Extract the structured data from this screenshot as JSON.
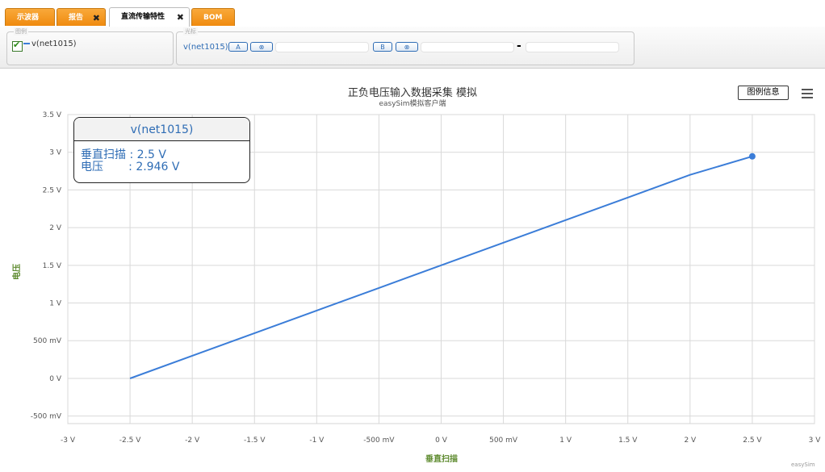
{
  "tabs": [
    {
      "label": "示波器",
      "closable": false,
      "active": false
    },
    {
      "label": "报告",
      "closable": true,
      "active": false
    },
    {
      "label": "直流传输特性",
      "closable": true,
      "active": true
    },
    {
      "label": "BOM",
      "closable": false,
      "active": false
    }
  ],
  "legend_panel": {
    "label": "图例",
    "items": [
      {
        "label": "v(net1015)",
        "checked": true
      }
    ]
  },
  "cursor_panel": {
    "label": "光标",
    "signal": "v(net1015)",
    "btn_a": "A",
    "btn_b": "B",
    "clear_icon": "⊗",
    "separator": "-"
  },
  "chart": {
    "title": "正负电压输入数据采集 模拟",
    "subtitle": "easySim模拟客户端",
    "info_button": "图例信息",
    "credit": "easySim"
  },
  "tooltip": {
    "header": "v(net1015)",
    "row1": "垂直扫描 : 2.5 V",
    "row2": "电压       : 2.946 V"
  },
  "colors": {
    "series": "#3b7dd8",
    "tab": "#ef8a0e",
    "axis_title": "#5d8a2e"
  },
  "chart_data": {
    "type": "line",
    "title": "正负电压输入数据采集 模拟",
    "subtitle": "easySim模拟客户端",
    "xlabel": "垂直扫描",
    "ylabel": "电压",
    "xlim": [
      -3,
      3
    ],
    "ylim": [
      -0.6,
      3.5
    ],
    "x_ticks": [
      {
        "v": -3,
        "label": "-3 V"
      },
      {
        "v": -2.5,
        "label": "-2.5 V"
      },
      {
        "v": -2,
        "label": "-2 V"
      },
      {
        "v": -1.5,
        "label": "-1.5 V"
      },
      {
        "v": -1,
        "label": "-1 V"
      },
      {
        "v": -0.5,
        "label": "-500 mV"
      },
      {
        "v": 0,
        "label": "0 V"
      },
      {
        "v": 0.5,
        "label": "500 mV"
      },
      {
        "v": 1,
        "label": "1 V"
      },
      {
        "v": 1.5,
        "label": "1.5 V"
      },
      {
        "v": 2,
        "label": "2 V"
      },
      {
        "v": 2.5,
        "label": "2.5 V"
      },
      {
        "v": 3,
        "label": "3 V"
      }
    ],
    "y_ticks": [
      {
        "v": -0.5,
        "label": "-500 mV"
      },
      {
        "v": 0,
        "label": "0 V"
      },
      {
        "v": 0.5,
        "label": "500 mV"
      },
      {
        "v": 1,
        "label": "1 V"
      },
      {
        "v": 1.5,
        "label": "1.5 V"
      },
      {
        "v": 2,
        "label": "2 V"
      },
      {
        "v": 2.5,
        "label": "2.5 V"
      },
      {
        "v": 3,
        "label": "3 V"
      },
      {
        "v": 3.5,
        "label": "3.5 V"
      }
    ],
    "series": [
      {
        "name": "v(net1015)",
        "color": "#3b7dd8",
        "x": [
          -2.5,
          -2,
          -1.5,
          -1,
          -0.5,
          0,
          0.5,
          1,
          1.5,
          2,
          2.5
        ],
        "y": [
          0.0,
          0.3,
          0.6,
          0.9,
          1.2,
          1.5,
          1.8,
          2.1,
          2.4,
          2.7,
          2.946
        ]
      }
    ],
    "highlight": {
      "x": 2.5,
      "y": 2.946
    },
    "grid": true,
    "legend": "none"
  }
}
